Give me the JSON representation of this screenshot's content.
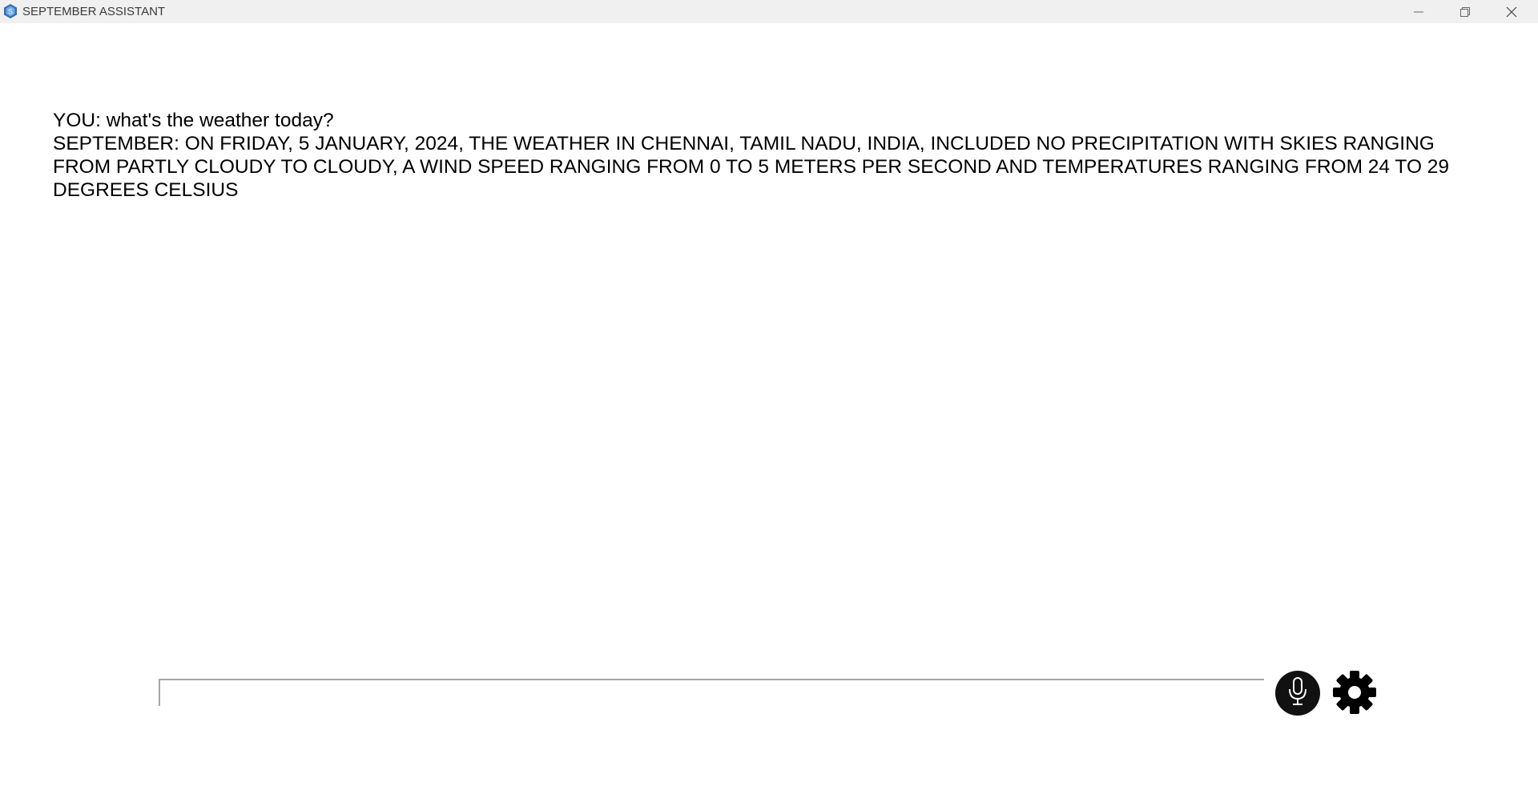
{
  "window": {
    "title": "SEPTEMBER ASSISTANT",
    "app_icon": "app-logo-icon",
    "controls": [
      "minimize-icon",
      "maximize-icon",
      "close-icon"
    ]
  },
  "chat": {
    "messages": [
      {
        "text": "YOU: what's the weather today?"
      },
      {
        "text": "SEPTEMBER: ON FRIDAY, 5 JANUARY, 2024, THE WEATHER IN CHENNAI, TAMIL NADU, INDIA, INCLUDED NO PRECIPITATION WITH SKIES RANGING FROM PARTLY CLOUDY TO CLOUDY, A WIND SPEED RANGING FROM 0 TO 5 METERS PER SECOND AND TEMPERATURES RANGING FROM 24 TO 29 DEGREES CELSIUS"
      }
    ]
  },
  "input": {
    "value": "",
    "placeholder": ""
  },
  "buttons": {
    "mic_icon": "microphone-icon",
    "settings_icon": "gear-icon"
  },
  "colors": {
    "titlebar": "#f0f0f0",
    "background": "#ffffff",
    "text": "#000000",
    "button": "#111111"
  }
}
